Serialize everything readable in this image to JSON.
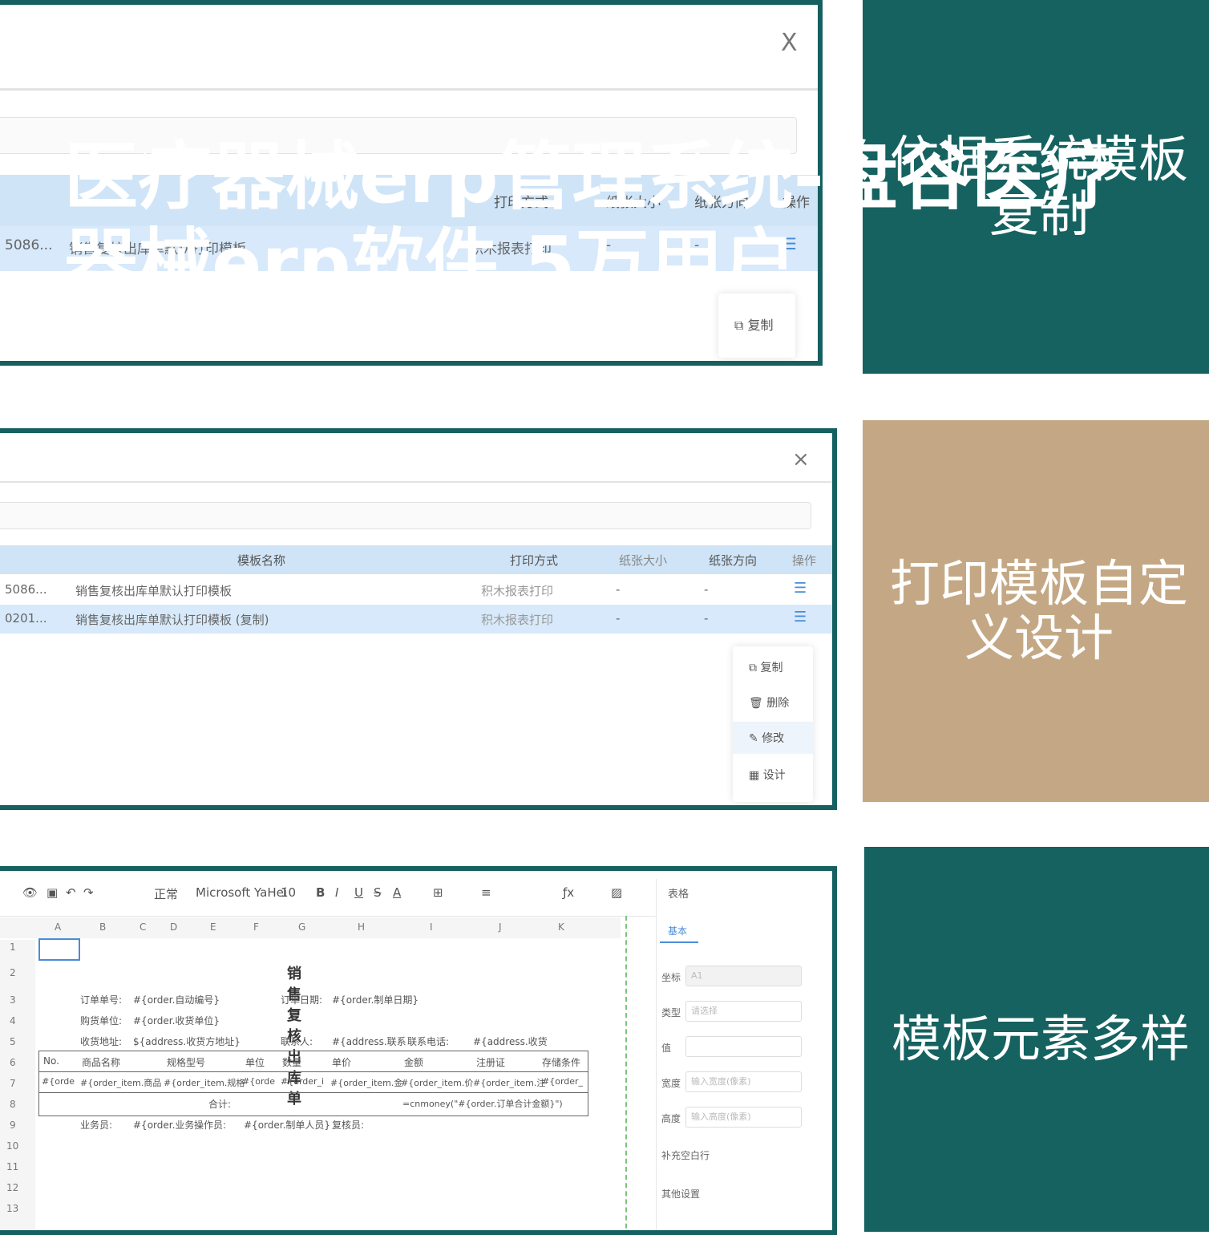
{
  "overlay_title": {
    "line1": "医疗器械erp管理系统-盘谷医疗",
    "line2": "器械erp软件 5万用户"
  },
  "cards": [
    {
      "text": "依据系统模板复制"
    },
    {
      "text": "打印模板自定义设计"
    },
    {
      "text": "模板元素多样"
    }
  ],
  "colors": {
    "teal": "#156260",
    "tan": "#c4a885",
    "header_blue": "#cfe4f7"
  },
  "panel1": {
    "close": "X",
    "headers": [
      "模板名称",
      "打印方式",
      "纸张大小",
      "纸张方向",
      "操作"
    ],
    "row": {
      "id": "5086...",
      "name": "销售复核出库单默认打印模板",
      "method": "积木报表打印",
      "size": "-",
      "dir": "-"
    },
    "menu": [
      "复制"
    ]
  },
  "panel2": {
    "close": "×",
    "headers": [
      "模板名称",
      "打印方式",
      "纸张大小",
      "纸张方向",
      "操作"
    ],
    "rows": [
      {
        "id": "5086...",
        "name": "销售复核出库单默认打印模板",
        "method": "积木报表打印",
        "size": "-",
        "dir": "-"
      },
      {
        "id": "0201...",
        "name": "销售复核出库单默认打印模板 (复制)",
        "method": "积木报表打印",
        "size": "-",
        "dir": "-"
      }
    ],
    "menu": [
      "复制",
      "删除",
      "修改",
      "设计"
    ]
  },
  "panel3": {
    "toolbar": [
      "正常",
      "Microsoft YaHei",
      "10",
      "B",
      "I",
      "U",
      "S",
      "A"
    ],
    "columns": [
      "A",
      "B",
      "C",
      "D",
      "E",
      "F",
      "G",
      "H",
      "I",
      "J",
      "K"
    ],
    "rows": [
      "1",
      "2",
      "3",
      "4",
      "5",
      "6",
      "7",
      "8",
      "9",
      "10",
      "11",
      "12",
      "13"
    ],
    "sheet_title": "销售复核出库单",
    "fields": {
      "order_no": "订单单号:",
      "order_no_val": "#{order.自动编号}",
      "order_date": "订单日期:",
      "order_date_val": "#{order.制单日期}",
      "buyer": "购货单位:",
      "buyer_val": "#{order.收货单位}",
      "address": "收货地址:",
      "address_val": "${address.收货方地址}",
      "contact": "联系人:",
      "contact_val": "#{address.联系",
      "phone": "联系电话:",
      "phone_val": "#{address.收货",
      "total_label": "合计:",
      "total_val": "=cnmoney(\"#{order.订单合计金额}\")",
      "sales": "业务员:",
      "sales_val": "#{order.业务",
      "operator": "操作员:",
      "operator_val": "#{order.制单人员}",
      "reviewer": "复核员:"
    },
    "table_headers": [
      "No.",
      "商品名称",
      "规格型号",
      "单位",
      "数量",
      "单价",
      "金额",
      "注册证",
      "存储条件"
    ],
    "table_row": [
      "#{orde",
      "#{order_item.商品",
      "#{order_item.规格",
      "#{orde",
      "#{order_i",
      "#{order_item.金",
      "#{order_item.价",
      "#{order_item.注",
      "#{order_"
    ],
    "side": {
      "title": "表格",
      "tab": "基本",
      "labels": [
        "坐标",
        "类型",
        "值",
        "宽度",
        "高度",
        "补充空白行",
        "其他设置"
      ],
      "placeholders": [
        "A1",
        "请选择",
        "",
        "输入宽度(像素)",
        "输入高度(像素)"
      ]
    }
  }
}
